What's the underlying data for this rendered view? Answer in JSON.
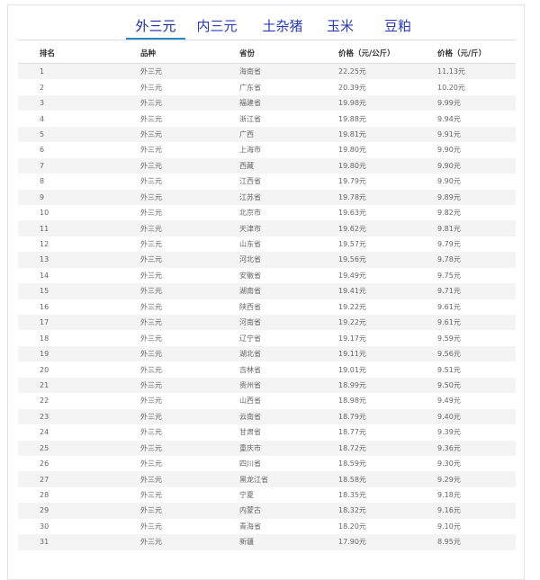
{
  "tabs": [
    {
      "label": "外三元",
      "active": true
    },
    {
      "label": "内三元",
      "active": false
    },
    {
      "label": "土杂猪",
      "active": false
    },
    {
      "label": "玉米",
      "active": false
    },
    {
      "label": "豆粕",
      "active": false
    }
  ],
  "table": {
    "headers": [
      "排名",
      "品种",
      "省份",
      "价格（元/公斤）",
      "价格（元/斤）"
    ],
    "rows": [
      [
        "1",
        "外三元",
        "海南省",
        "22.25元",
        "11.13元"
      ],
      [
        "2",
        "外三元",
        "广东省",
        "20.39元",
        "10.20元"
      ],
      [
        "3",
        "外三元",
        "福建省",
        "19.98元",
        "9.99元"
      ],
      [
        "4",
        "外三元",
        "浙江省",
        "19.88元",
        "9.94元"
      ],
      [
        "5",
        "外三元",
        "广西",
        "19.81元",
        "9.91元"
      ],
      [
        "6",
        "外三元",
        "上海市",
        "19.80元",
        "9.90元"
      ],
      [
        "7",
        "外三元",
        "西藏",
        "19.80元",
        "9.90元"
      ],
      [
        "8",
        "外三元",
        "江西省",
        "19.79元",
        "9.90元"
      ],
      [
        "9",
        "外三元",
        "江苏省",
        "19.78元",
        "9.89元"
      ],
      [
        "10",
        "外三元",
        "北京市",
        "19.63元",
        "9.82元"
      ],
      [
        "11",
        "外三元",
        "天津市",
        "19.62元",
        "9.81元"
      ],
      [
        "12",
        "外三元",
        "山东省",
        "19.57元",
        "9.79元"
      ],
      [
        "13",
        "外三元",
        "河北省",
        "19.56元",
        "9.78元"
      ],
      [
        "14",
        "外三元",
        "安徽省",
        "19.49元",
        "9.75元"
      ],
      [
        "15",
        "外三元",
        "湖南省",
        "19.41元",
        "9.71元"
      ],
      [
        "16",
        "外三元",
        "陕西省",
        "19.22元",
        "9.61元"
      ],
      [
        "17",
        "外三元",
        "河南省",
        "19.22元",
        "9.61元"
      ],
      [
        "18",
        "外三元",
        "辽宁省",
        "19.17元",
        "9.59元"
      ],
      [
        "19",
        "外三元",
        "湖北省",
        "19.11元",
        "9.56元"
      ],
      [
        "20",
        "外三元",
        "吉林省",
        "19.01元",
        "9.51元"
      ],
      [
        "21",
        "外三元",
        "贵州省",
        "18.99元",
        "9.50元"
      ],
      [
        "22",
        "外三元",
        "山西省",
        "18.98元",
        "9.49元"
      ],
      [
        "23",
        "外三元",
        "云南省",
        "18.79元",
        "9.40元"
      ],
      [
        "24",
        "外三元",
        "甘肃省",
        "18.77元",
        "9.39元"
      ],
      [
        "25",
        "外三元",
        "重庆市",
        "18.72元",
        "9.36元"
      ],
      [
        "26",
        "外三元",
        "四川省",
        "18.59元",
        "9.30元"
      ],
      [
        "27",
        "外三元",
        "黑龙江省",
        "18.58元",
        "9.29元"
      ],
      [
        "28",
        "外三元",
        "宁夏",
        "18.35元",
        "9.18元"
      ],
      [
        "29",
        "外三元",
        "内蒙古",
        "18.32元",
        "9.16元"
      ],
      [
        "30",
        "外三元",
        "青海省",
        "18.20元",
        "9.10元"
      ],
      [
        "31",
        "外三元",
        "新疆",
        "17.90元",
        "8.95元"
      ]
    ]
  },
  "colors": {
    "tab_text": "#2a3bb8",
    "tab_underline": "#2c86c4",
    "row_stripe": "#f4f4f4"
  }
}
